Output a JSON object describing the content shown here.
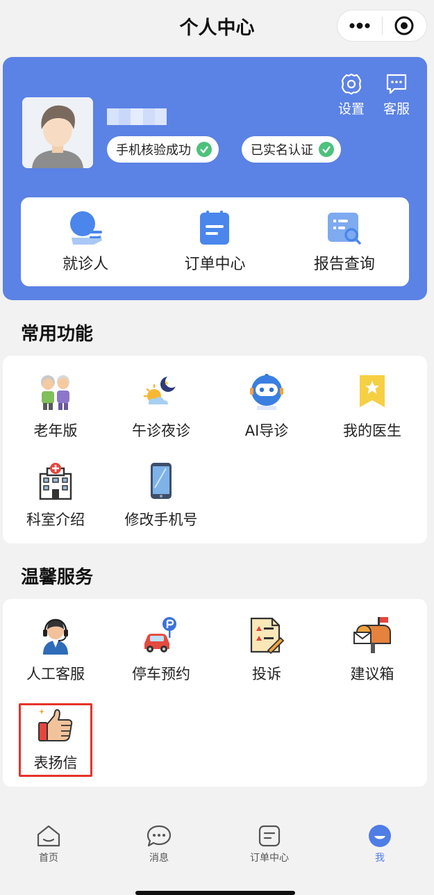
{
  "nav": {
    "title": "个人中心"
  },
  "profile": {
    "badges": [
      "手机核验成功",
      "已实名认证"
    ],
    "tools": {
      "settings": "设置",
      "service": "客服"
    },
    "quick": [
      "就诊人",
      "订单中心",
      "报告查询"
    ]
  },
  "common": {
    "title": "常用功能",
    "items": [
      "老年版",
      "午诊夜诊",
      "AI导诊",
      "我的医生",
      "科室介绍",
      "修改手机号"
    ]
  },
  "warm": {
    "title": "温馨服务",
    "items": [
      "人工客服",
      "停车预约",
      "投诉",
      "建议箱",
      "表扬信"
    ]
  },
  "tabbar": {
    "tabs": [
      "首页",
      "消息",
      "订单中心",
      "我"
    ]
  },
  "colors": {
    "primary": "#5b82e5",
    "accent": "#4f7de6",
    "check": "#4cc27c",
    "highlight": "#e5332a"
  }
}
